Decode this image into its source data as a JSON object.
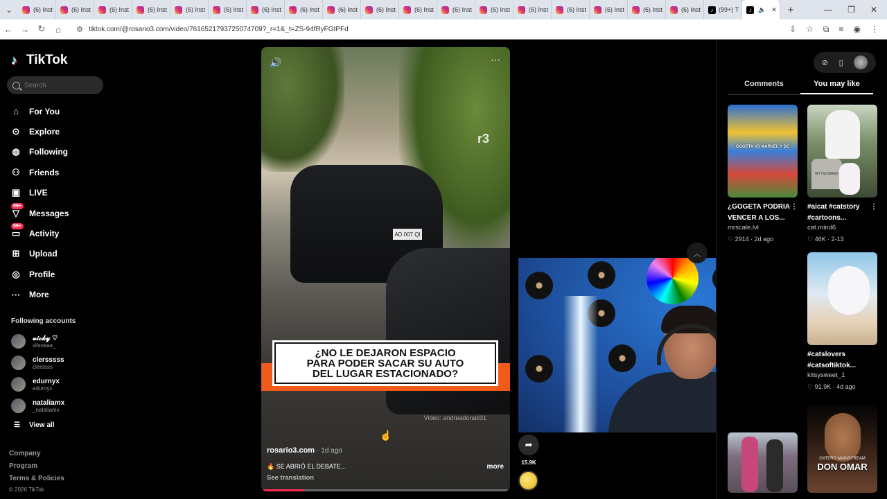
{
  "browser": {
    "tabs": [
      {
        "label": "(6) Inst",
        "icon": "instagram-icon"
      },
      {
        "label": "(6) Inst",
        "icon": "instagram-icon"
      },
      {
        "label": "(6) Inst",
        "icon": "instagram-icon"
      },
      {
        "label": "(6) Inst",
        "icon": "instagram-icon"
      },
      {
        "label": "(6) Inst",
        "icon": "instagram-icon"
      },
      {
        "label": "(6) Inst",
        "icon": "instagram-icon"
      },
      {
        "label": "(6) Inst",
        "icon": "instagram-icon"
      },
      {
        "label": "(6) Inst",
        "icon": "instagram-icon"
      },
      {
        "label": "(6) Inst",
        "icon": "instagram-icon"
      },
      {
        "label": "(6) Inst",
        "icon": "instagram-icon"
      },
      {
        "label": "(6) Inst",
        "icon": "instagram-icon"
      },
      {
        "label": "(6) Inst",
        "icon": "instagram-icon"
      },
      {
        "label": "(6) Inst",
        "icon": "instagram-icon"
      },
      {
        "label": "(6) Inst",
        "icon": "instagram-icon"
      },
      {
        "label": "(6) Inst",
        "icon": "instagram-icon"
      },
      {
        "label": "(6) Inst",
        "icon": "instagram-icon"
      },
      {
        "label": "(6) Inst",
        "icon": "instagram-icon"
      },
      {
        "label": "(6) Inst",
        "icon": "instagram-icon"
      },
      {
        "label": "(99+) T",
        "icon": "tiktok-icon"
      }
    ],
    "url": "tiktok.com/@rosario3.com/video/7616521793725074709?_r=1&_t=ZS-94fRyFGtPFd"
  },
  "sidebar": {
    "brand": "TikTok",
    "search_placeholder": "Search",
    "nav": [
      {
        "label": "For You",
        "icon": "home-icon"
      },
      {
        "label": "Explore",
        "icon": "compass-icon"
      },
      {
        "label": "Following",
        "icon": "following-icon"
      },
      {
        "label": "Friends",
        "icon": "friends-icon"
      },
      {
        "label": "LIVE",
        "icon": "live-icon"
      },
      {
        "label": "Messages",
        "icon": "messages-icon",
        "badge": "99+"
      },
      {
        "label": "Activity",
        "icon": "activity-icon",
        "badge": "99+"
      },
      {
        "label": "Upload",
        "icon": "upload-icon"
      },
      {
        "label": "Profile",
        "icon": "profile-icon"
      },
      {
        "label": "More",
        "icon": "more-icon"
      }
    ],
    "following_title": "Following accounts",
    "accounts": [
      {
        "name": "𝓿𝓲𝓬𝓴𝔂 ♡",
        "handle": "vlisosaa_"
      },
      {
        "name": "clersssss",
        "handle": "clerssss"
      },
      {
        "name": "edurnyx",
        "handle": "edurnyx"
      },
      {
        "name": "nataliamx",
        "handle": "_nataliamx"
      }
    ],
    "view_all": "View all",
    "footer_links": [
      "Company",
      "Program",
      "Terms & Policies"
    ],
    "copyright": "© 2026 TikTok"
  },
  "video": {
    "overlay_caption": "¿NO LE DEJARON ESPACIO\nPARA PODER SACAR SU AUTO\nDEL LUGAR ESTACIONADO?",
    "plate_text": "AD 007 QI",
    "channel_mark": "r3",
    "watermark": "Video: andreadonati31",
    "author": "rosario3.com",
    "posted": "· 1d ago",
    "description": "🔥 SE ABRIÓ EL DEBATE...",
    "more_label": "more",
    "see_translation": "See translation",
    "progress": 0.17,
    "share_count": "15.9K"
  },
  "right_panel": {
    "tabs": [
      "Comments",
      "You may like"
    ],
    "selected_tab": "You may like",
    "cards": [
      {
        "title": "¿GOGETA PODRIA VENCER A LOS...",
        "author": "mrscale.lvl",
        "likes": "2914",
        "ago": "2d ago"
      },
      {
        "title": "#aicat #catstory #cartoons...",
        "author": "cat.mind6",
        "likes": "46K",
        "ago": "2-13"
      },
      {
        "title": "#catslovers #catsoftiktok...",
        "author": "kitsysweet_1",
        "likes": "91.9K",
        "ago": "4d ago"
      },
      {
        "title": "",
        "author": "",
        "likes": "",
        "ago": ""
      },
      {
        "title": "",
        "author": "",
        "likes": "",
        "ago": ""
      }
    ],
    "gogeta_thumb_text": "GOGETA VS MARVEL Y DC",
    "tombstone_text": "MY HUSBAND",
    "don_omar_text": "DON OMAR",
    "don_omar_sub": "GATERO MAINSTREAM"
  }
}
